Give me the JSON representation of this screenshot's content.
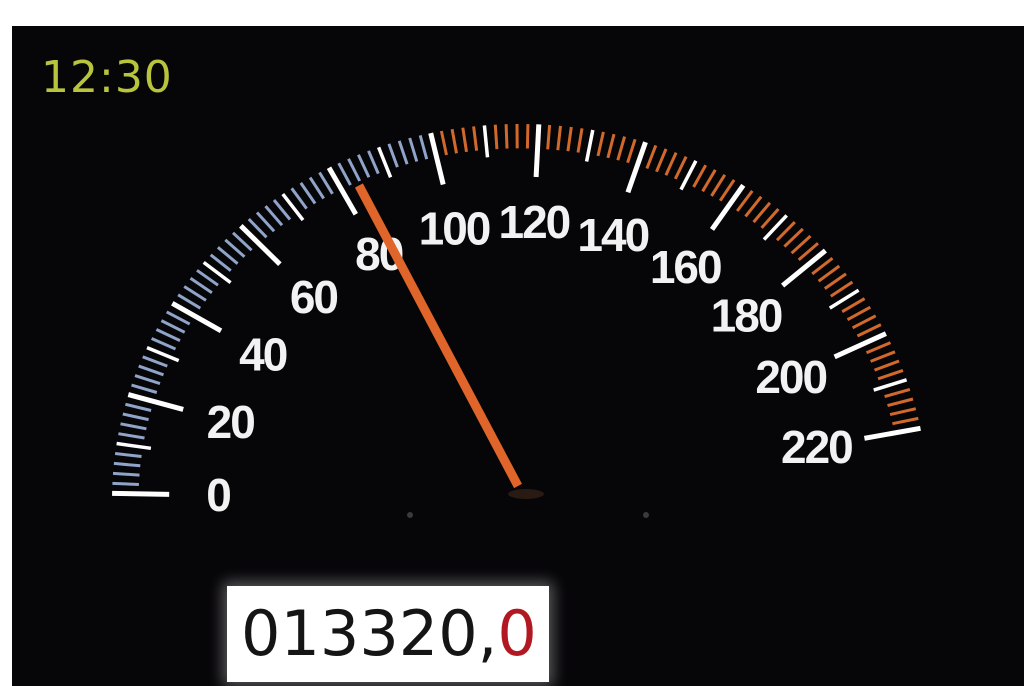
{
  "clock": {
    "time": "12:30"
  },
  "speedometer": {
    "current_speed": 80,
    "min": 0,
    "max": 220,
    "scale_labels": [
      "0",
      "20",
      "40",
      "60",
      "80",
      "100",
      "120",
      "140",
      "160",
      "180",
      "200",
      "220"
    ],
    "colors": {
      "background": "#060508",
      "low_ticks": "#8fa4c8",
      "high_ticks": "#d2692c",
      "major_ticks": "#ffffff",
      "needle": "#e0652a",
      "clock": "#b7c43c",
      "odometer_decimal": "#b21822"
    }
  },
  "odometer": {
    "integer": "013320,",
    "decimal": "0"
  }
}
